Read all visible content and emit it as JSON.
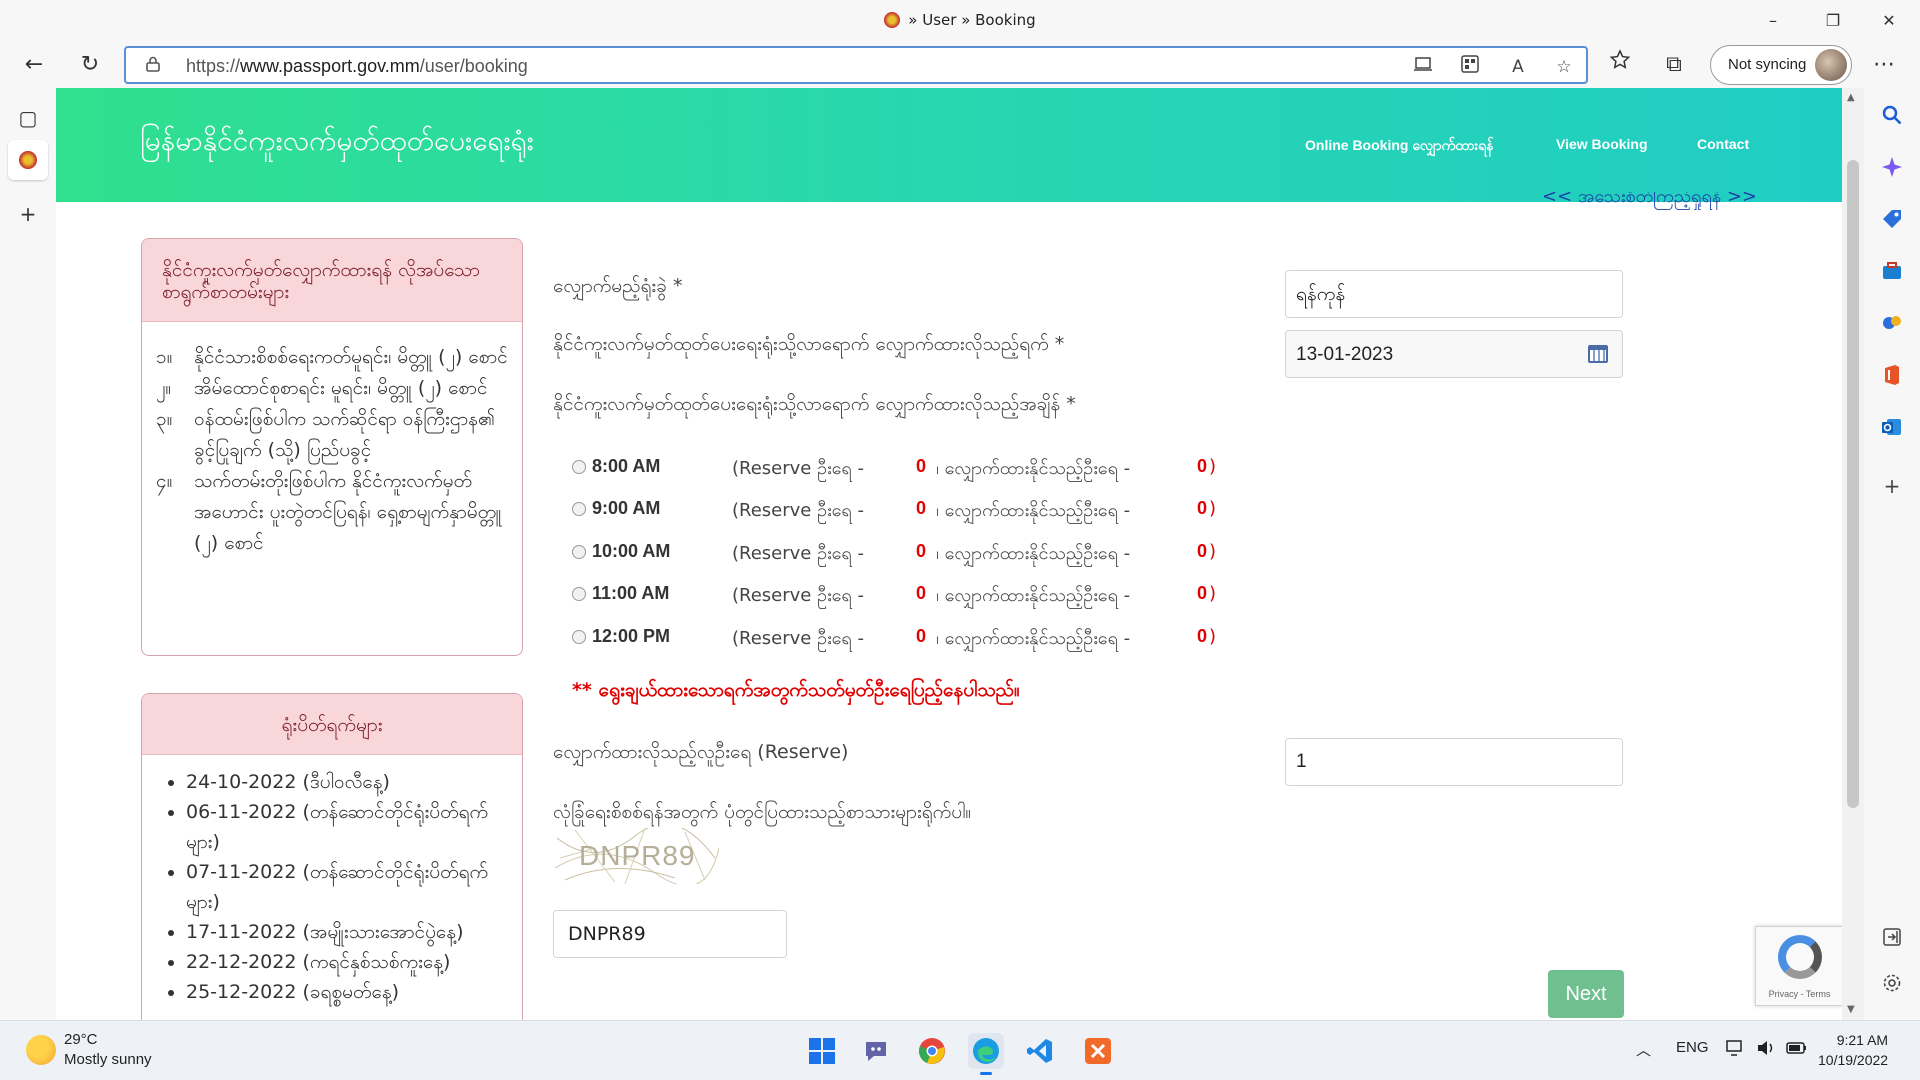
{
  "browser": {
    "tab_title": "» User » Booking",
    "url_prefix": "https://",
    "url_host": "www.passport.gov.mm",
    "url_path": "/user/booking",
    "profile_label": "Not syncing",
    "window_controls": {
      "minimize": "–",
      "maximize": "❐",
      "close": "✕"
    },
    "icons": {
      "back": "←",
      "refresh": "↻",
      "lock": "🔒",
      "read_aloud": "A",
      "more": "⋯",
      "favorites": "☆",
      "collections": "⧉",
      "new_tab": "+",
      "tab_actions": "▢"
    }
  },
  "site": {
    "brand": "မြန်မာနိုင်ငံကူးလက်မှတ်ထုတ်ပေးရေးရုံး",
    "nav": [
      "Online Booking လျှောက်ထားရန်",
      "View Booking",
      "Contact"
    ],
    "partial_link": "<< အသေးစိတ်ကြည့်ရှုရန် >>"
  },
  "requirements_panel": {
    "title": "နိုင်ငံကူးလက်မှတ်လျှောက်ထားရန် လိုအပ်သောစာရွက်စာတမ်းများ",
    "items": [
      {
        "num": "၁။",
        "text": "နိုင်ငံသားစိစစ်ရေးကတ်မူရင်း၊ မိတ္တူ (၂) စောင်"
      },
      {
        "num": "၂။",
        "text": "အိမ်ထောင်စုစာရင်း မူရင်း၊ မိတ္တူ (၂) စောင်"
      },
      {
        "num": "၃။",
        "text": "ဝန်ထမ်းဖြစ်ပါက သက်ဆိုင်ရာ ဝန်ကြီးဌာန၏ ခွင့်ပြုချက် (သို့) ပြည်ပခွင့်"
      },
      {
        "num": "၄။",
        "text": "သက်တမ်းတိုးဖြစ်ပါက နိုင်ငံကူးလက်မှတ်အဟောင်း ပူးတွဲတင်ပြရန်၊ ရှေ့စာမျက်နှာမိတ္တူ (၂) စောင်"
      }
    ]
  },
  "holidays_panel": {
    "title": "ရုံးပိတ်ရက်များ",
    "items": [
      "24-10-2022 (ဒီပါဝလီနေ့)",
      "06-11-2022 (တန်ဆောင်တိုင်ရုံးပိတ်ရက်များ)",
      "07-11-2022 (တန်ဆောင်တိုင်ရုံးပိတ်ရက်များ)",
      "17-11-2022 (အမျိုးသားအောင်ပွဲနေ့)",
      "22-12-2022 (ကရင်နှစ်သစ်ကူးနေ့)",
      "25-12-2022 (ခရစ္စမတ်နေ့)"
    ]
  },
  "form": {
    "office_label": "လျှောက်မည့်ရုံးခွဲ *",
    "office_value": "ရန်ကုန်",
    "date_label": "နိုင်ငံကူးလက်မှတ်ထုတ်ပေးရေးရုံးသို့လာရောက် လျှောက်ထားလိုသည့်ရက် *",
    "date_value": "13-01-2023",
    "time_label": "နိုင်ငံကူးလက်မှတ်ထုတ်ပေးရေးရုံးသို့လာရောက် လျှောက်ထားလိုသည့်အချိန် *",
    "slots": [
      {
        "time": "8:00 AM",
        "reserve_label": "(Reserve ဦးရေ -",
        "reserve": "0",
        "available_label": "၊ လျှောက်ထားနိုင်သည့်ဦးရေ -",
        "available": "0",
        "close": ")"
      },
      {
        "time": "9:00 AM",
        "reserve_label": "(Reserve ဦးရေ -",
        "reserve": "0",
        "available_label": "၊ လျှောက်ထားနိုင်သည့်ဦးရေ -",
        "available": "0",
        "close": ")"
      },
      {
        "time": "10:00 AM",
        "reserve_label": "(Reserve ဦးရေ -",
        "reserve": "0",
        "available_label": "၊ လျှောက်ထားနိုင်သည့်ဦးရေ -",
        "available": "0",
        "close": ")"
      },
      {
        "time": "11:00 AM",
        "reserve_label": "(Reserve ဦးရေ -",
        "reserve": "0",
        "available_label": "၊ လျှောက်ထားနိုင်သည့်ဦးရေ -",
        "available": "0",
        "close": ")"
      },
      {
        "time": "12:00 PM",
        "reserve_label": "(Reserve ဦးရေ -",
        "reserve": "0",
        "available_label": "၊ လျှောက်ထားနိုင်သည့်ဦးရေ -",
        "available": "0",
        "close": ")"
      }
    ],
    "note": "** ရွေးချယ်ထားသောရက်အတွက်သတ်မှတ်ဦးရေပြည့်နေပါသည်။",
    "reserve_count_label": "လျှောက်ထားလိုသည့်လူဦးရေ (Reserve)",
    "reserve_count_value": "1",
    "captcha_label": "လုံခြုံရေးစိစစ်ရန်အတွက် ပုံတွင်ပြထားသည့်စာသားများရိုက်ပါ။",
    "captcha_image_text": "DNPR89",
    "captcha_value": "DNPR89",
    "next_label": "Next",
    "recaptcha_terms": "Privacy - Terms"
  },
  "taskbar": {
    "temperature": "29°C",
    "weather": "Mostly sunny",
    "language": "ENG",
    "time": "9:21 AM",
    "date": "10/19/2022"
  }
}
